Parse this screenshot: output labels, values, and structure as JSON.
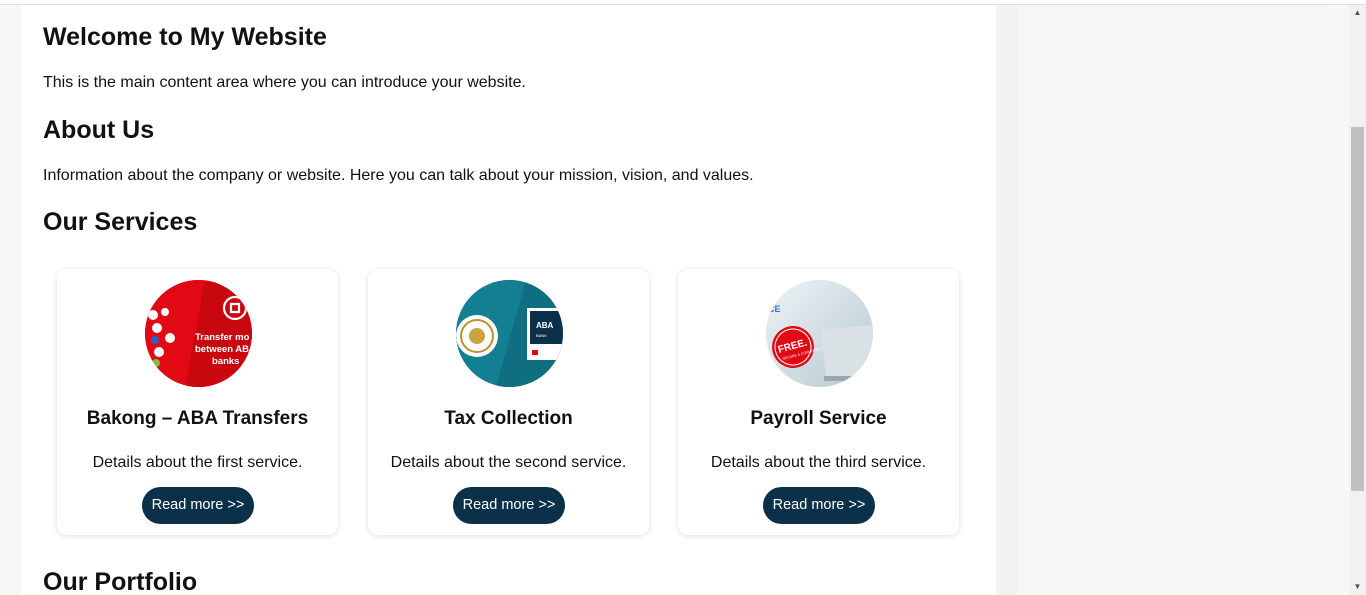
{
  "main": {
    "title": "Welcome to My Website",
    "intro": "This is the main content area where you can introduce your website.",
    "about_heading": "About Us",
    "about_text": "Information about the company or website. Here you can talk about your mission, vision, and values.",
    "services_heading": "Our Services",
    "portfolio_heading": "Our Portfolio"
  },
  "services": [
    {
      "title": "Bakong – ABA Transfers",
      "description": "Details about the first service.",
      "button": "Read more >>",
      "image_text": [
        "Transfer mo",
        "between AB",
        "banks"
      ]
    },
    {
      "title": "Tax Collection",
      "description": "Details about the second service.",
      "button": "Read more >>",
      "image_text": [
        "ABA",
        "BANK"
      ]
    },
    {
      "title": "Payroll Service",
      "description": "Details about the third service.",
      "button": "Read more >>",
      "image_text": [
        "CE",
        "FREE.",
        "SECURE & CONVENIENT"
      ]
    }
  ],
  "colors": {
    "button_bg": "#0a3149",
    "aba_red": "#e10a14",
    "teal": "#137f92"
  },
  "scrollbar": {
    "up_arrow": "▲",
    "down_arrow": "▼"
  }
}
